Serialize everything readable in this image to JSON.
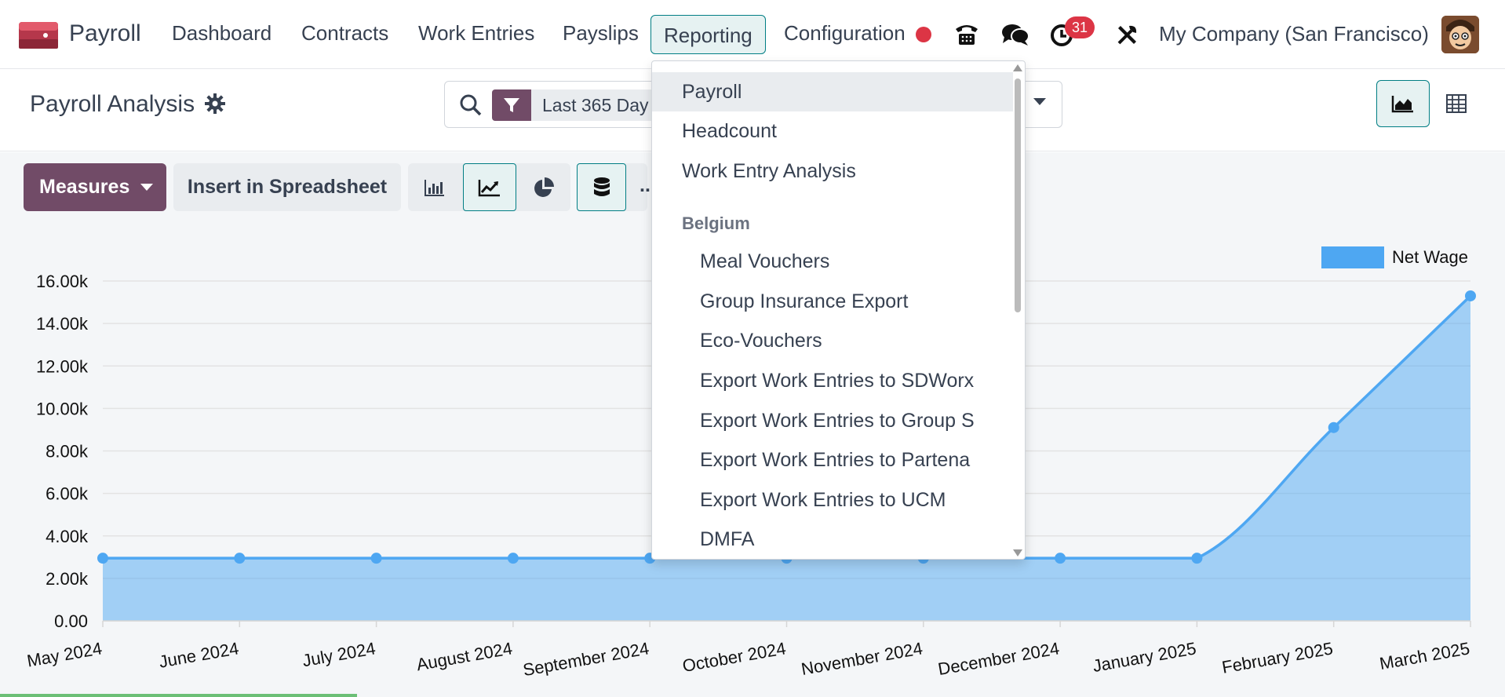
{
  "navbar": {
    "app_name": "Payroll",
    "menu": [
      "Dashboard",
      "Contracts",
      "Work Entries",
      "Payslips",
      "Reporting",
      "Configuration"
    ],
    "active_menu": "Reporting",
    "activity_count": "31",
    "company": "My Company (San Francisco)"
  },
  "control_panel": {
    "title": "Payroll Analysis",
    "facet": "Last 365 Day"
  },
  "toolbar": {
    "measures_label": "Measures",
    "insert_label": "Insert in Spreadsheet",
    "more_label": ".."
  },
  "dropdown": {
    "items": [
      "Payroll",
      "Headcount",
      "Work Entry Analysis"
    ],
    "section_header": "Belgium",
    "sub_items": [
      "Meal Vouchers",
      "Group Insurance Export",
      "Eco-Vouchers",
      "Export Work Entries to SDWorx",
      "Export Work Entries to Group S",
      "Export Work Entries to Partena",
      "Export Work Entries to UCM",
      "DMFA"
    ]
  },
  "chart_data": {
    "type": "area",
    "title": "",
    "xlabel": "",
    "ylabel": "",
    "categories": [
      "May 2024",
      "June 2024",
      "July 2024",
      "August 2024",
      "September 2024",
      "October 2024",
      "November 2024",
      "December 2024",
      "January 2025",
      "February 2025",
      "March 2025"
    ],
    "series": [
      {
        "name": "Net Wage",
        "values": [
          2950,
          2950,
          2950,
          2950,
          2950,
          2950,
          2950,
          2950,
          2950,
          9100,
          15300
        ]
      }
    ],
    "ylim": [
      0,
      16000
    ],
    "yticks": [
      "0.00",
      "2.00k",
      "4.00k",
      "6.00k",
      "8.00k",
      "10.00k",
      "12.00k",
      "14.00k",
      "16.00k"
    ],
    "grid": true,
    "legend": "top-right",
    "color": "#4ea7f2"
  }
}
